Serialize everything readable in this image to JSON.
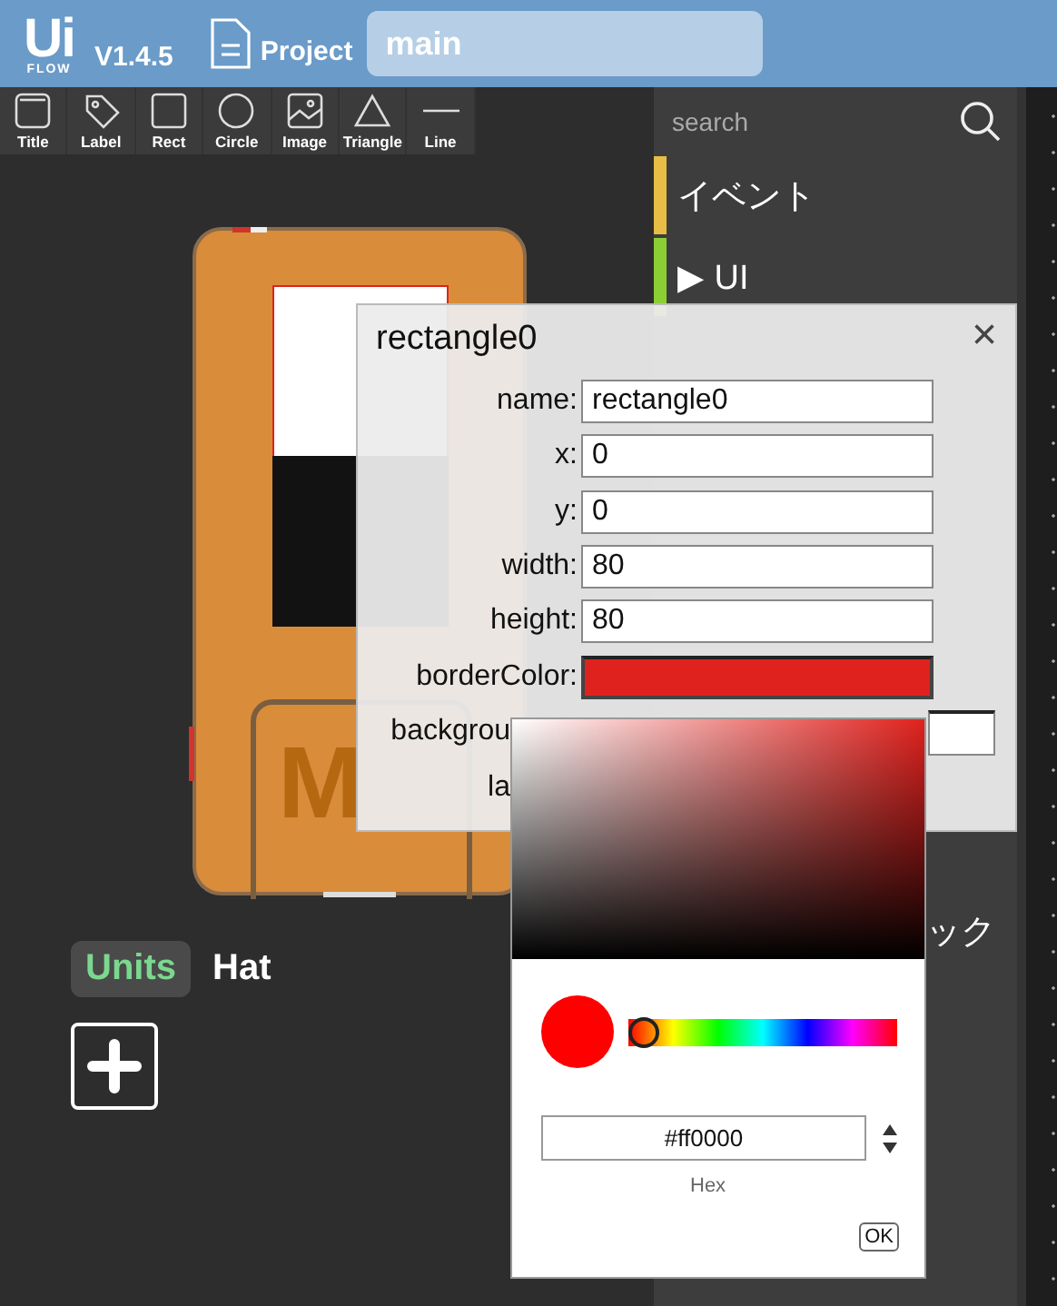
{
  "header": {
    "logo_main": "Ui",
    "logo_sub": "FLOW",
    "version": "V1.4.5",
    "project_label": "Project",
    "file_name": "main"
  },
  "shape_tools": [
    {
      "label": "Title",
      "kind": "title"
    },
    {
      "label": "Label",
      "kind": "label"
    },
    {
      "label": "Rect",
      "kind": "rect"
    },
    {
      "label": "Circle",
      "kind": "circle"
    },
    {
      "label": "Image",
      "kind": "image"
    },
    {
      "label": "Triangle",
      "kind": "triangle"
    },
    {
      "label": "Line",
      "kind": "line"
    }
  ],
  "device": {
    "logo": "M"
  },
  "sidebar": {
    "search_placeholder": "search",
    "categories": [
      {
        "label": "イベント",
        "color": "#e8bd45",
        "kind": "plain"
      },
      {
        "label": "UI",
        "arrow": "▶",
        "color": "#8ccf35",
        "kind": "plain"
      },
      {
        "label": "ック",
        "kind": "clipped"
      }
    ]
  },
  "tabs": [
    {
      "label": "Units",
      "selected": true
    },
    {
      "label": "Hat",
      "selected": false
    }
  ],
  "dialog": {
    "title": "rectangle0",
    "close": "×",
    "fields": [
      {
        "label": "name:",
        "value": "rectangle0",
        "kind": "text"
      },
      {
        "label": "x:",
        "value": "0",
        "kind": "text"
      },
      {
        "label": "y:",
        "value": "0",
        "kind": "text"
      },
      {
        "label": "width:",
        "value": "80",
        "kind": "text"
      },
      {
        "label": "height:",
        "value": "80",
        "kind": "text"
      },
      {
        "label": "borderColor:",
        "color": "#e0221e",
        "kind": "color"
      },
      {
        "label": "backgrou",
        "kind": "clipped_field"
      },
      {
        "label": "la",
        "kind": "clipped"
      }
    ]
  },
  "color_picker": {
    "hue": {
      "level": 0
    },
    "hex": "#ff0000",
    "format_label": "Hex",
    "ok": "OK"
  }
}
